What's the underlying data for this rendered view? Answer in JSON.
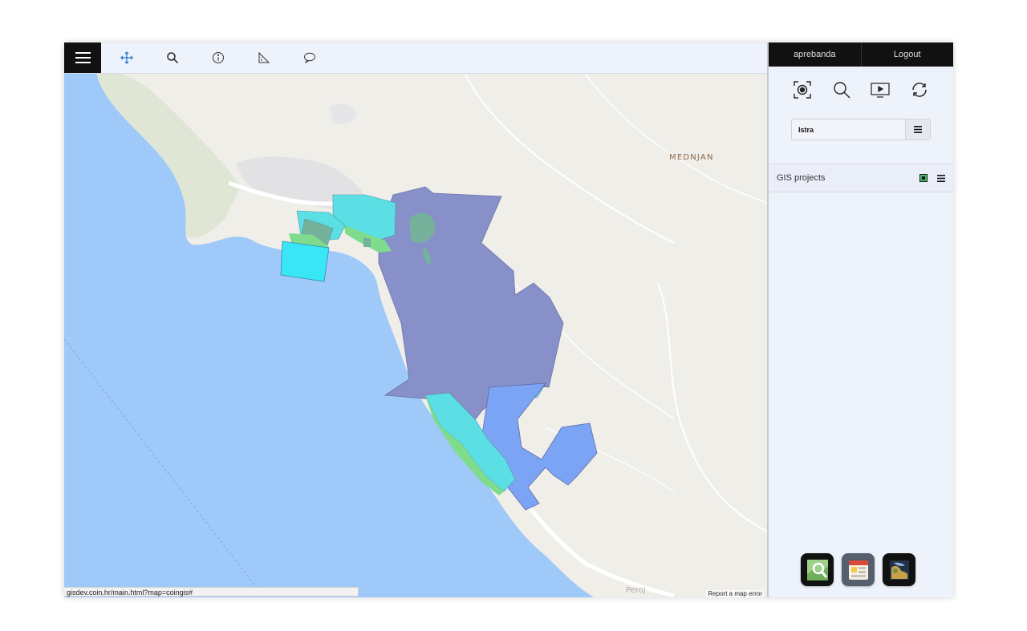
{
  "colors": {
    "sea": "#9fc9f9",
    "land": "#f0eee9",
    "green_land": "#dfe6d6",
    "zone_blue": "#8790c8",
    "zone_lightblue": "#7ca4f5",
    "zone_cyan": "#5cdfe4",
    "zone_green": "#7fdc8c",
    "accent": "#2b79d2"
  },
  "toolbar": {
    "menu_icon": "hamburger-menu-icon",
    "tools": [
      "pan-icon",
      "search-icon",
      "info-icon",
      "measure-icon",
      "comment-icon"
    ]
  },
  "map": {
    "town_label": "MEDNJAN",
    "place_label": "Peroj",
    "status_url": "gisdev.coin.hr/main.html?map=coingis#",
    "report_link": "Report a map error"
  },
  "side_panel": {
    "user": "aprebanda",
    "logout": "Logout",
    "tools": [
      "locate-icon",
      "search-icon",
      "presentation-icon",
      "refresh-icon"
    ],
    "project_value": "Istra",
    "section_title": "GIS projects",
    "apps": [
      "map-search-app-icon",
      "calendar-app-icon",
      "world-app-icon"
    ]
  }
}
